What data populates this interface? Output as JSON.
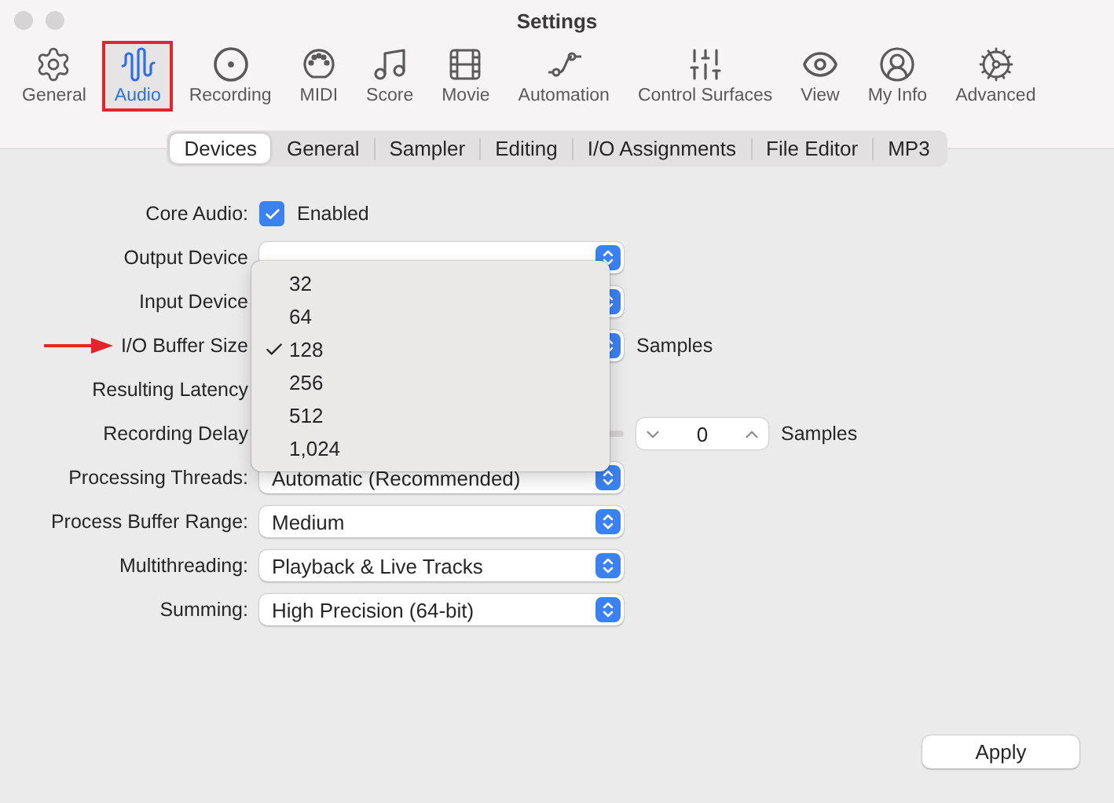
{
  "window": {
    "title": "Settings"
  },
  "toolbar": [
    {
      "label": "General",
      "selected": false,
      "annotated": false
    },
    {
      "label": "Audio",
      "selected": true,
      "annotated": true
    },
    {
      "label": "Recording",
      "selected": false,
      "annotated": false
    },
    {
      "label": "MIDI",
      "selected": false,
      "annotated": false
    },
    {
      "label": "Score",
      "selected": false,
      "annotated": false
    },
    {
      "label": "Movie",
      "selected": false,
      "annotated": false
    },
    {
      "label": "Automation",
      "selected": false,
      "annotated": false
    },
    {
      "label": "Control Surfaces",
      "selected": false,
      "annotated": false
    },
    {
      "label": "View",
      "selected": false,
      "annotated": false
    },
    {
      "label": "My Info",
      "selected": false,
      "annotated": false
    },
    {
      "label": "Advanced",
      "selected": false,
      "annotated": false
    }
  ],
  "tabs": [
    {
      "label": "Devices",
      "selected": true
    },
    {
      "label": "General",
      "selected": false
    },
    {
      "label": "Sampler",
      "selected": false
    },
    {
      "label": "Editing",
      "selected": false
    },
    {
      "label": "I/O Assignments",
      "selected": false
    },
    {
      "label": "File Editor",
      "selected": false
    },
    {
      "label": "MP3",
      "selected": false
    }
  ],
  "rows": [
    {
      "kind": "checkbox",
      "label": "Core Audio:",
      "checked": true,
      "text": "Enabled"
    },
    {
      "kind": "popup",
      "label": "Output Device"
    },
    {
      "kind": "popup",
      "label": "Input Device"
    },
    {
      "kind": "popup",
      "label": "I/O Buffer Size",
      "units": "Samples",
      "annotated": true
    },
    {
      "kind": "info",
      "label": "Resulting Latency"
    },
    {
      "kind": "stepper",
      "label": "Recording Delay",
      "value": "0",
      "units": "Samples"
    },
    {
      "kind": "popup",
      "label": "Processing Threads:",
      "value": "Automatic (Recommended)"
    },
    {
      "kind": "popup",
      "label": "Process Buffer Range:",
      "value": "Medium"
    },
    {
      "kind": "popup",
      "label": "Multithreading:",
      "value": "Playback & Live Tracks"
    },
    {
      "kind": "popup",
      "label": "Summing:",
      "value": "High Precision (64-bit)"
    }
  ],
  "menu": [
    {
      "label": "32",
      "selected": false
    },
    {
      "label": "64",
      "selected": false
    },
    {
      "label": "128",
      "selected": true
    },
    {
      "label": "256",
      "selected": false
    },
    {
      "label": "512",
      "selected": false
    },
    {
      "label": "1,024",
      "selected": false
    }
  ],
  "apply_button": "Apply"
}
